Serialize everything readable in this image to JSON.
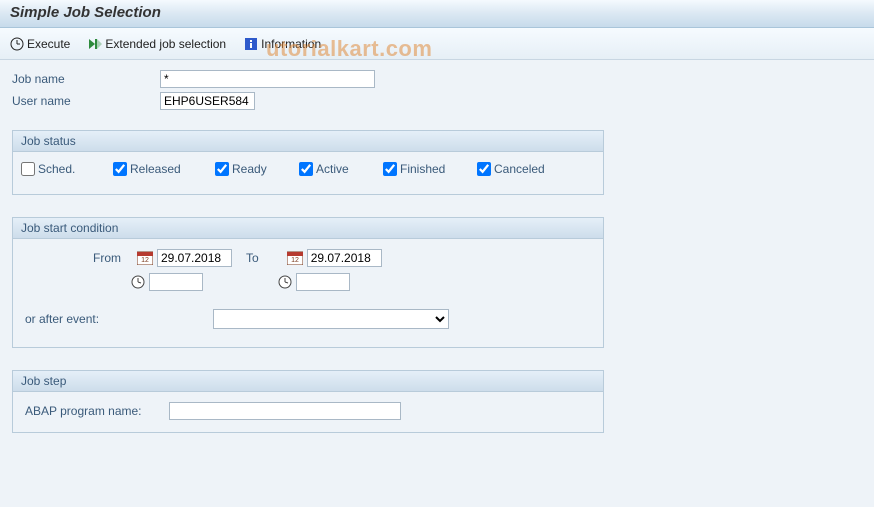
{
  "header": {
    "title": "Simple Job Selection"
  },
  "toolbar": {
    "execute_label": "Execute",
    "extended_label": "Extended job selection",
    "info_label": "Information"
  },
  "fields": {
    "jobname_label": "Job name",
    "jobname_value": "*",
    "username_label": "User name",
    "username_value": "EHP6USER584"
  },
  "status": {
    "group_title": "Job status",
    "items": [
      {
        "label": "Sched.",
        "checked": false
      },
      {
        "label": "Released",
        "checked": true
      },
      {
        "label": "Ready",
        "checked": true
      },
      {
        "label": "Active",
        "checked": true
      },
      {
        "label": "Finished",
        "checked": true
      },
      {
        "label": "Canceled",
        "checked": true
      }
    ]
  },
  "condition": {
    "group_title": "Job start condition",
    "from_label": "From",
    "to_label": "To",
    "from_date": "29.07.2018",
    "to_date": "29.07.2018",
    "from_time": "",
    "to_time": "",
    "event_label": "or after event:",
    "event_value": ""
  },
  "step": {
    "group_title": "Job step",
    "abap_label": "ABAP program name:",
    "abap_value": ""
  },
  "watermark": "utorialkart.com"
}
